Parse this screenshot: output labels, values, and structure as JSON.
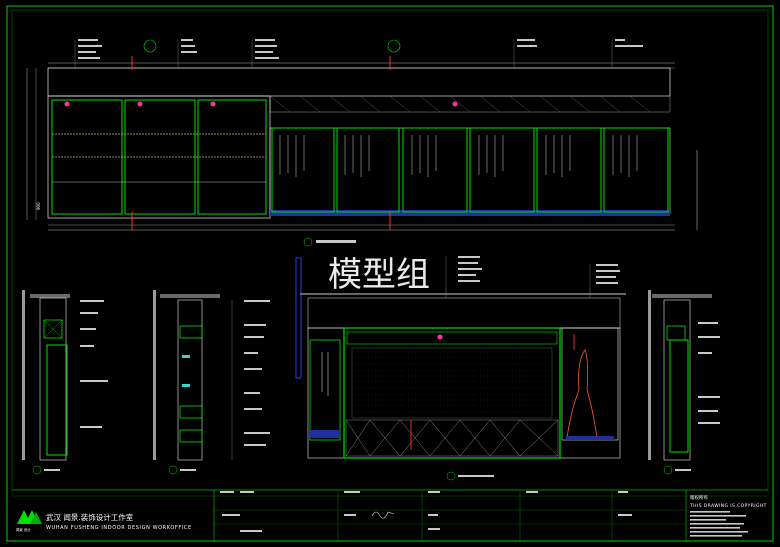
{
  "watermark": "模型组",
  "dimension_label": "900",
  "studio": {
    "name_cn": "武汉 闻景.装饰设计工作室",
    "name_en": "WUHAN FUSHENG INDOOR DESIGN WORKOFFICE",
    "logo_caption": "闻景 设计"
  },
  "copyright": {
    "heading": "版权所有",
    "line": "THIS DRAWING IS COPYRIGHT"
  },
  "colors": {
    "background": "#000000",
    "frame": "#00d000",
    "shelving": "#00e000",
    "walls": "#e8e8e8",
    "marker": "#ff3030",
    "accent": "#ff2fa0",
    "dimension": "#b0b0b0",
    "watermark": "#ffffff"
  }
}
